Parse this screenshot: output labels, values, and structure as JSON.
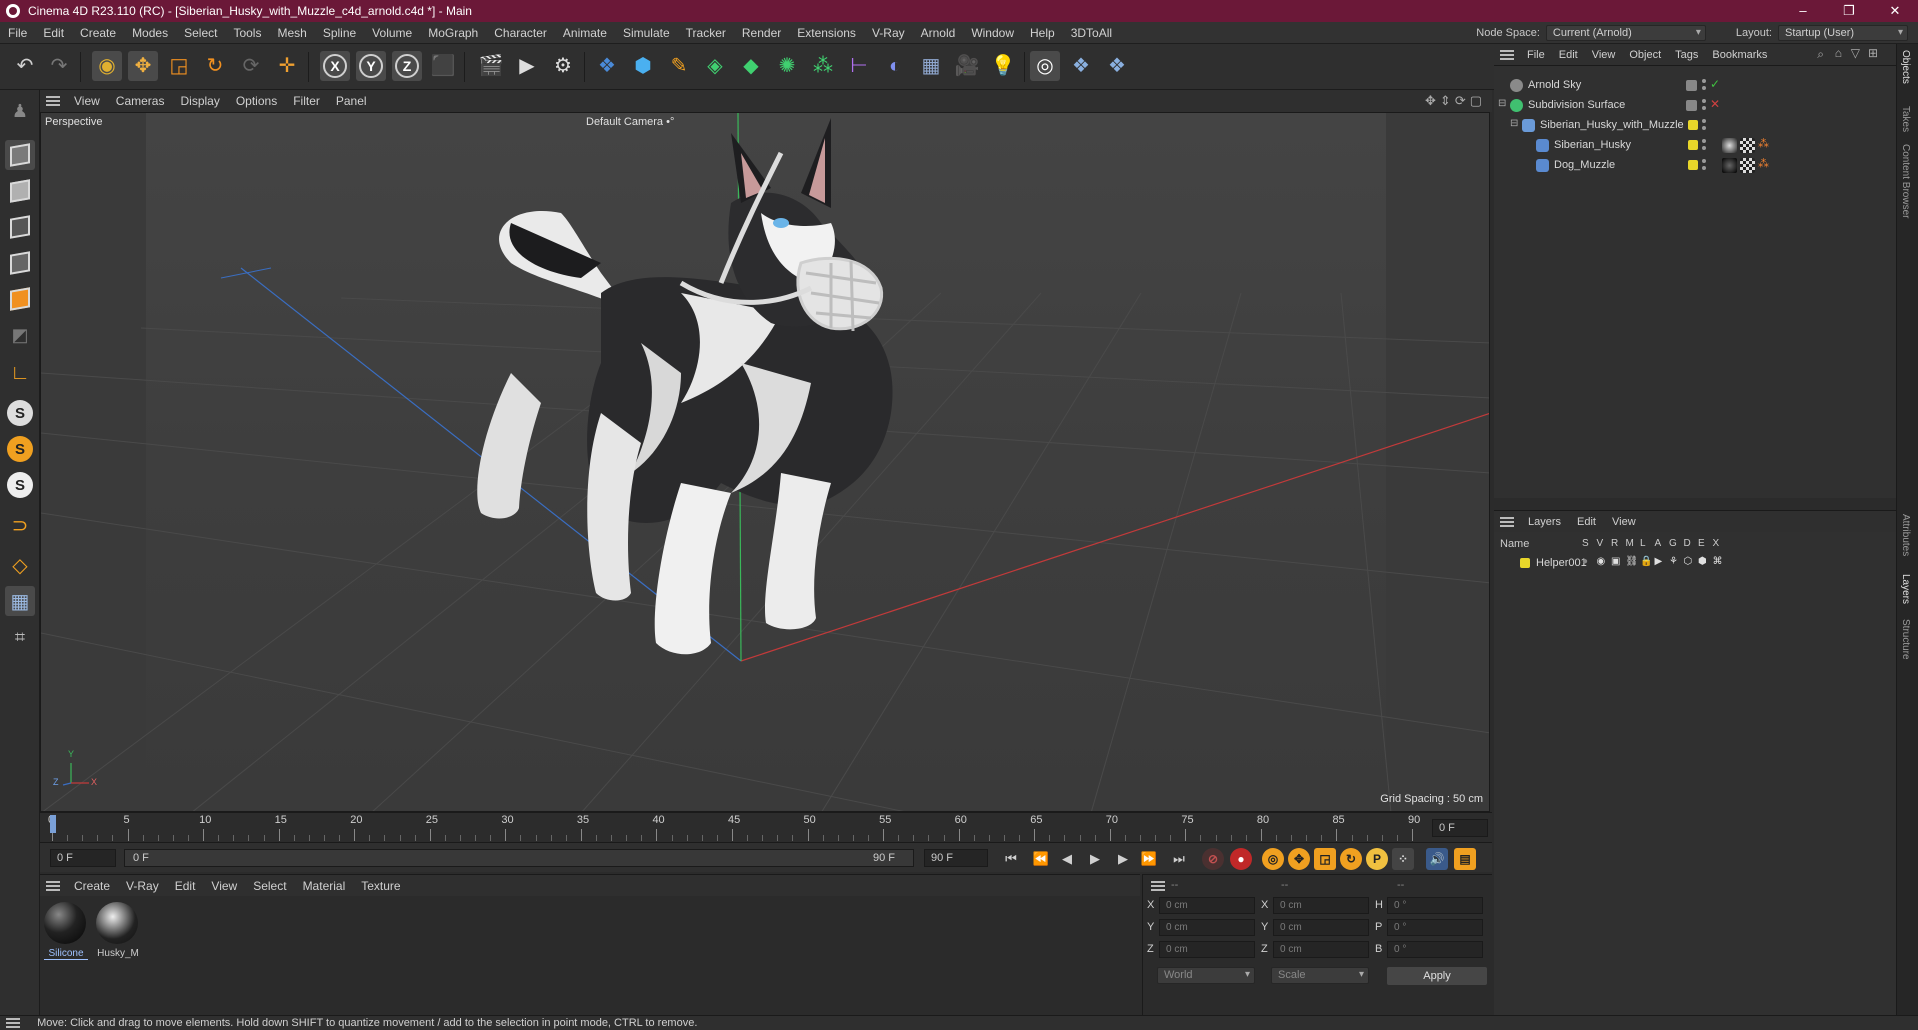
{
  "window": {
    "title": "Cinema 4D R23.110 (RC) - [Siberian_Husky_with_Muzzle_c4d_arnold.c4d *] - Main",
    "minimize": "–",
    "restore": "❐",
    "close": "✕"
  },
  "menubar": {
    "items": [
      "File",
      "Edit",
      "Create",
      "Modes",
      "Select",
      "Tools",
      "Mesh",
      "Spline",
      "Volume",
      "MoGraph",
      "Character",
      "Animate",
      "Simulate",
      "Tracker",
      "Render",
      "Extensions",
      "V-Ray",
      "Arnold",
      "Window",
      "Help",
      "3DToAll"
    ],
    "node_space_label": "Node Space:",
    "node_space_value": "Current (Arnold)",
    "layout_label": "Layout:",
    "layout_value": "Startup (User)"
  },
  "toolbar": {
    "axis_x": "X",
    "axis_y": "Y",
    "axis_z": "Z"
  },
  "viewport": {
    "menu": [
      "View",
      "Cameras",
      "Display",
      "Options",
      "Filter",
      "Panel"
    ],
    "projection": "Perspective",
    "camera": "Default Camera",
    "camera_suffix": "•°",
    "grid_spacing": "Grid Spacing : 50 cm",
    "axis_y": "Y",
    "axis_z": "Z",
    "axis_x": "X",
    "colors": {
      "grid_bg": "#3a3a3a",
      "x_axis": "#c23a3a",
      "y_axis": "#3ab85a",
      "z_axis": "#3a6ec2"
    }
  },
  "timeline": {
    "ticks": [
      "0",
      "5",
      "10",
      "15",
      "20",
      "25",
      "30",
      "35",
      "40",
      "45",
      "50",
      "55",
      "60",
      "65",
      "70",
      "75",
      "80",
      "85",
      "90"
    ],
    "current_frame": "0 F"
  },
  "transport": {
    "start_field": "0 F",
    "range_start": "0 F",
    "range_end": "90 F",
    "end_field": "90 F"
  },
  "materials": {
    "menu": [
      "Create",
      "V-Ray",
      "Edit",
      "View",
      "Select",
      "Material",
      "Texture"
    ],
    "items": [
      {
        "label": "Silicone",
        "selected": true
      },
      {
        "label": "Husky_M",
        "selected": false
      }
    ]
  },
  "coords": {
    "header": [
      "--",
      "--",
      "--"
    ],
    "rows": [
      {
        "l1": "X",
        "v1": "0 cm",
        "l2": "X",
        "v2": "0 cm",
        "l3": "H",
        "v3": "0 °"
      },
      {
        "l1": "Y",
        "v1": "0 cm",
        "l2": "Y",
        "v2": "0 cm",
        "l3": "P",
        "v3": "0 °"
      },
      {
        "l1": "Z",
        "v1": "0 cm",
        "l2": "Z",
        "v2": "0 cm",
        "l3": "B",
        "v3": "0 °"
      }
    ],
    "space": "World",
    "mode": "Scale",
    "apply": "Apply"
  },
  "objects": {
    "menu": [
      "File",
      "Edit",
      "View",
      "Object",
      "Tags",
      "Bookmarks"
    ],
    "rows": [
      {
        "name": "Arnold Sky"
      },
      {
        "name": "Subdivision Surface"
      },
      {
        "name": "Siberian_Husky_with_Muzzle"
      },
      {
        "name": "Siberian_Husky"
      },
      {
        "name": "Dog_Muzzle"
      }
    ]
  },
  "layers": {
    "menu": [
      "Layers",
      "Edit",
      "View"
    ],
    "header_name": "Name",
    "columns": [
      "S",
      "V",
      "R",
      "M",
      "L",
      "A",
      "G",
      "D",
      "E",
      "X"
    ],
    "rows": [
      {
        "name": "Helper001",
        "color": "#e8d62a"
      }
    ]
  },
  "side_tabs": [
    "Objects",
    "Takes",
    "Content Browser",
    "Attributes",
    "Layers",
    "Structure"
  ],
  "status": "Move: Click and drag to move elements. Hold down SHIFT to quantize movement / add to the selection in point mode, CTRL to remove."
}
